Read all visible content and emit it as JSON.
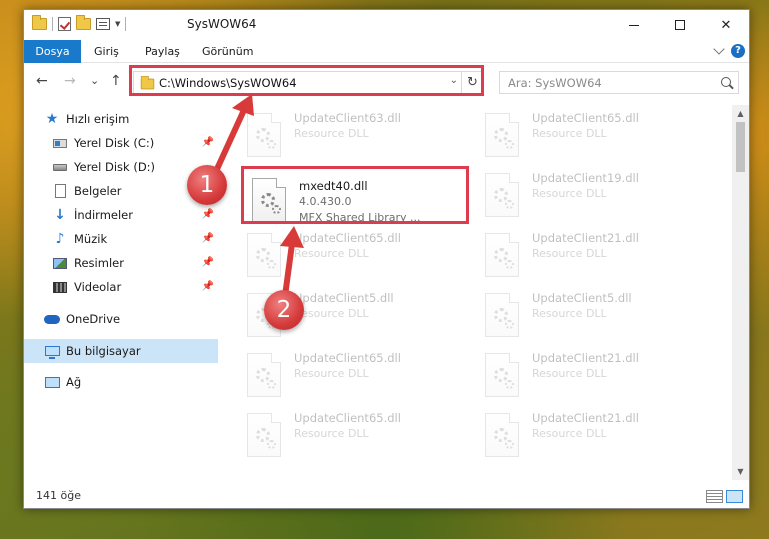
{
  "window": {
    "title": "SysWOW64",
    "minimize": "—",
    "close": "✕"
  },
  "ribbon": {
    "tabs": [
      "Dosya",
      "Giriş",
      "Paylaş",
      "Görünüm"
    ],
    "help": "?"
  },
  "address": {
    "path": "C:\\Windows\\SysWOW64",
    "refresh": "↻",
    "dropdown": "⌄",
    "back": "←",
    "forward": "→",
    "recent": "⌄",
    "up": "↑"
  },
  "search": {
    "placeholder": "Ara: SysWOW64"
  },
  "nav": {
    "items": [
      {
        "label": "Hızlı erişim"
      },
      {
        "label": "Yerel Disk (C:)"
      },
      {
        "label": "Yerel Disk (D:)"
      },
      {
        "label": "Belgeler"
      },
      {
        "label": "İndirmeler"
      },
      {
        "label": "Müzik"
      },
      {
        "label": "Resimler"
      },
      {
        "label": "Videolar"
      },
      {
        "label": "OneDrive"
      },
      {
        "label": "Bu bilgisayar"
      },
      {
        "label": "Ağ"
      }
    ]
  },
  "files": {
    "highlighted": {
      "name": "mxedt40.dll",
      "version": "4.0.430.0",
      "description": "MFX Shared Library ..."
    },
    "left": [
      {
        "name": "UpdateClient63.dll",
        "type": "Resource DLL"
      },
      {
        "name": "UpdateClient65.dll",
        "type": "Resource DLL"
      },
      {
        "name": "UpdateClient5.dll",
        "type": "Resource DLL"
      },
      {
        "name": "UpdateClient65.dll",
        "type": "Resource DLL"
      },
      {
        "name": "UpdateClient65.dll",
        "type": "Resource DLL"
      }
    ],
    "right": [
      {
        "name": "UpdateClient65.dll",
        "type": "Resource DLL"
      },
      {
        "name": "UpdateClient19.dll",
        "type": "Resource DLL"
      },
      {
        "name": "UpdateClient21.dll",
        "type": "Resource DLL"
      },
      {
        "name": "UpdateClient5.dll",
        "type": "Resource DLL"
      },
      {
        "name": "UpdateClient21.dll",
        "type": "Resource DLL"
      },
      {
        "name": "UpdateClient21.dll",
        "type": "Resource DLL"
      }
    ]
  },
  "status": {
    "count": "141 öğe"
  },
  "annotations": {
    "step1": "1",
    "step2": "2",
    "highlight_color": "#dd3b4e"
  }
}
